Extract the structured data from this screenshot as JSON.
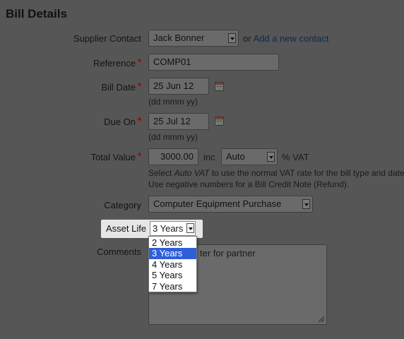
{
  "page_title": "Bill Details",
  "supplier_contact": {
    "label": "Supplier Contact",
    "value": "Jack Bonner",
    "or_text": "or",
    "add_link": "Add a new contact"
  },
  "reference": {
    "label": "Reference",
    "value": "COMP01",
    "required_mark": "*"
  },
  "bill_date": {
    "label": "Bill Date",
    "value": "25 Jun 12",
    "hint": "(dd mmm yy)",
    "required_mark": "*"
  },
  "due_on": {
    "label": "Due On",
    "value": "25 Jul 12",
    "hint": "(dd mmm yy)",
    "required_mark": "*"
  },
  "total_value": {
    "label": "Total Value",
    "required_mark": "*",
    "value": "3000.00",
    "inc_text": "inc",
    "vat_option": "Auto",
    "vat_suffix": "% VAT",
    "help_line1_pre": "Select ",
    "help_line1_em": "Auto VAT",
    "help_line1_post": " to use the normal VAT rate for the bill type and date.",
    "help_line2": "Use negative numbers for a Bill Credit Note (Refund)."
  },
  "category": {
    "label": "Category",
    "value": "Computer Equipment Purchase"
  },
  "asset_life": {
    "label": "Asset Life",
    "value": "3 Years",
    "options": [
      "2 Years",
      "3 Years",
      "4 Years",
      "5 Years",
      "7 Years"
    ],
    "selected_index": 1
  },
  "comments": {
    "label": "Comments",
    "visible_text": "ter for partner"
  },
  "colors": {
    "selection": "#2f5fd8",
    "required": "#a40000",
    "link": "#0b2a55"
  }
}
